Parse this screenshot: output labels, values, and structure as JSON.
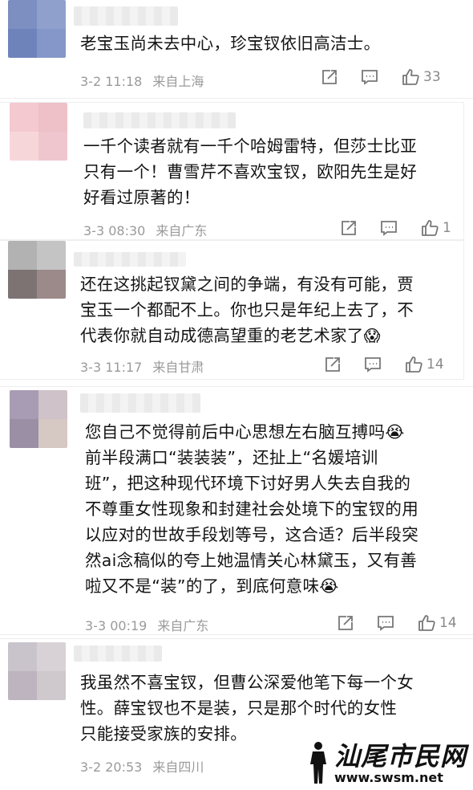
{
  "comments": [
    {
      "text": "老宝玉尚未去中心，珍宝钗依旧高洁士。",
      "time": "3-2 11:18",
      "source": "来自上海",
      "likes": "33",
      "avatar_colors": [
        "#7d8fc0",
        "#8fa0cc",
        "#6f83bb",
        "#8597c8"
      ]
    },
    {
      "text": "一千个读者就有一千个哈姆雷特，但莎士比亚\n只有一个！曹雪芹不喜欢宝钗，欧阳先生是好\n好看过原著的！",
      "time": "3-3 08:30",
      "source": "来自广东",
      "likes": "1",
      "avatar_colors": [
        "#f4c9cf",
        "#eec0c8",
        "#f7d6da",
        "#efc6cd"
      ]
    },
    {
      "text": "还在这挑起钗黛之间的争端，有没有可能，贾\n宝玉一个都配不上。你也只是年纪上去了，不\n代表你就自动成德高望重的老艺术家了",
      "emoji_after": "😱",
      "time": "3-3 11:17",
      "source": "来自甘肃",
      "likes": "14",
      "avatar_colors": [
        "#b2b2b2",
        "#c4c4c4",
        "#7d7373",
        "#9c8a8a"
      ]
    },
    {
      "text": "您自己不觉得前后中心思想左右脑互搏吗😭\n前半段满口“装装装”，还扯上“名媛培训\n班”，把这种现代环境下讨好男人失去自我的\n不尊重女性现象和封建社会处境下的宝钗的用\n以应对的世故手段划等号，这合适？后半段突\n然ai念稿似的夸上她温情关心林黛玉，又有善\n啦又不是“装”的了，到底何意味😭",
      "time": "3-3 00:19",
      "source": "来自广东",
      "likes": "14",
      "avatar_colors": [
        "#a89cb4",
        "#cfc2c8",
        "#9b8fa6",
        "#d6c8c2"
      ]
    },
    {
      "text": "我虽然不喜宝钗，但曹公深爱他笔下每一个女\n性。薛宝钗也不是装，只是那个时代的女性\n只能接受家族的安排。",
      "time": "3-2 20:53",
      "source": "来自四川",
      "likes": "",
      "avatar_colors": [
        "#c9c3cc",
        "#d8d2d6",
        "#bdb4bf",
        "#cfc8cd"
      ]
    }
  ],
  "watermark": {
    "name": "汕尾市民网",
    "url": "www.swsm.net"
  }
}
